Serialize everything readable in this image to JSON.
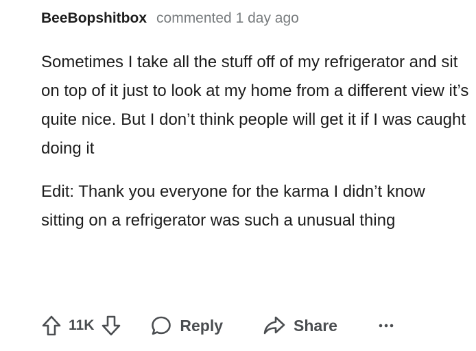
{
  "comment": {
    "author": "BeeBopshitbox",
    "meta": "commented 1 day ago",
    "paragraphs": [
      "Sometimes I take all the stuff off of my refrigerator and sit on top of it just to look at my home from a different view it’s quite nice. But I don’t think people will get it if I was caught doing it",
      "Edit: Thank you everyone for the karma I didn’t know sitting on a refrigerator was such a unusual thing"
    ]
  },
  "actions": {
    "vote_count": "11K",
    "reply_label": "Reply",
    "share_label": "Share",
    "more_label": "···"
  },
  "icons": {
    "upvote": "arrow-up-icon",
    "downvote": "arrow-down-icon",
    "reply": "speech-bubble-icon",
    "share": "share-arrow-icon",
    "more": "more-dots-icon"
  },
  "colors": {
    "text": "#1c1c1c",
    "meta": "#787c7e",
    "action": "#4a4d50"
  }
}
